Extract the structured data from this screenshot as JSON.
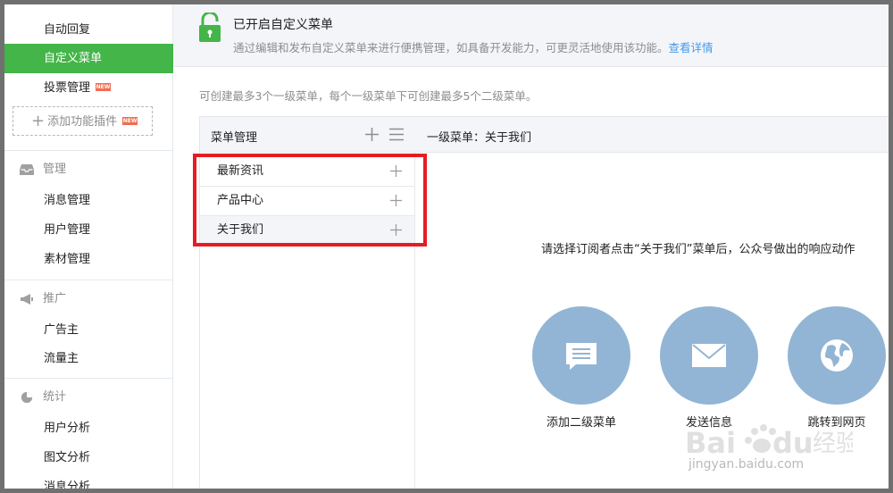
{
  "sidebar": {
    "items_top": [
      {
        "label": "自动回复"
      },
      {
        "label": "自定义菜单"
      },
      {
        "label": "投票管理",
        "badge": "NEW"
      }
    ],
    "add_plugin": {
      "label": "添加功能插件",
      "badge": "NEW"
    },
    "groups": [
      {
        "title": "管理",
        "icon": "inbox-icon",
        "items": [
          "消息管理",
          "用户管理",
          "素材管理"
        ]
      },
      {
        "title": "推广",
        "icon": "megaphone-icon",
        "items": [
          "广告主",
          "流量主"
        ]
      },
      {
        "title": "统计",
        "icon": "pie-chart-icon",
        "items": [
          "用户分析",
          "图文分析",
          "消息分析"
        ]
      }
    ]
  },
  "notice": {
    "icon": "lock-open-icon",
    "title": "已开启自定义菜单",
    "desc": "通过编辑和发布自定义菜单来进行便携管理，如具备开发能力，可更灵活地使用该功能。",
    "link": "查看详情"
  },
  "hint": "可创建最多3个一级菜单，每个一级菜单下可创建最多5个二级菜单。",
  "menu": {
    "title": "菜单管理",
    "items": [
      "最新资讯",
      "产品中心",
      "关于我们"
    ]
  },
  "detail": {
    "title": "一级菜单：关于我们",
    "prompt": "请选择订阅者点击“关于我们”菜单后，公众号做出的响应动作",
    "actions": [
      {
        "label": "添加二级菜单",
        "icon": "list-icon"
      },
      {
        "label": "发送信息",
        "icon": "envelope-icon"
      },
      {
        "label": "跳转到网页",
        "icon": "globe-icon"
      }
    ]
  },
  "watermark": {
    "text": "jingyan.baidu.com"
  },
  "colors": {
    "accent_green": "#44b549",
    "link_blue": "#459ae9",
    "action_blue": "#92b5d5",
    "highlight_red": "#e51c23"
  }
}
